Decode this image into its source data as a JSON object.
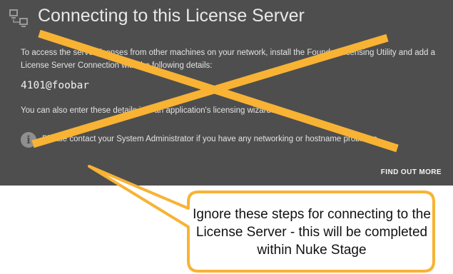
{
  "header": {
    "title": "Connecting to this License Server",
    "icon": "network-computers-icon"
  },
  "content": {
    "paragraph1": "To access the server licenses from other machines on your network, install the Foundry Licensing Utility and add a License Server Connection with the following details:",
    "server_address": "4101@foobar",
    "paragraph2": "You can also enter these details into an application's licensing wizard.",
    "note": "Please contact your System Administrator if you have any networking or hostname problems.",
    "info_icon": "info-icon",
    "find_out_more_label": "FIND OUT MORE"
  },
  "annotation": {
    "callout_text": "Ignore these steps for connecting to the License Server - this will be completed within Nuke Stage",
    "cross_color": "#f8b334",
    "bubble_border_color": "#f8b334"
  },
  "colors": {
    "panel_background": "#4e4e4e",
    "text": "#e3e3e3"
  }
}
